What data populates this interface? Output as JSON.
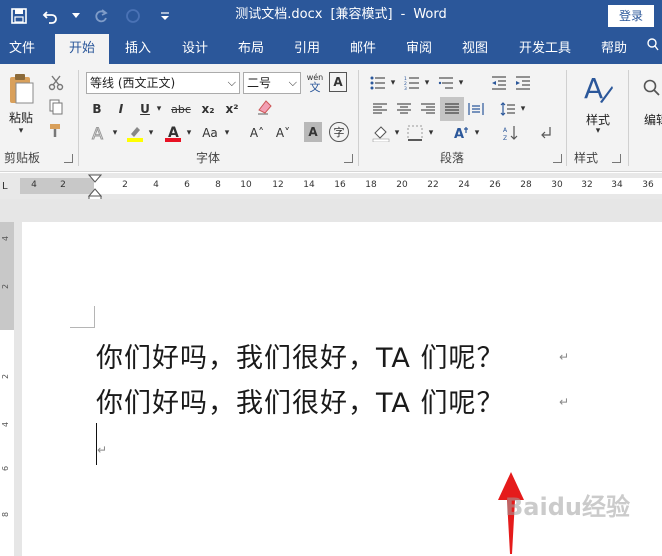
{
  "app": {
    "title_doc": "测试文档.docx",
    "title_mode": "[兼容模式]",
    "title_sep": "-",
    "app_name": "Word",
    "login_label": "登录"
  },
  "tabs": [
    "文件",
    "开始",
    "插入",
    "设计",
    "布局",
    "引用",
    "邮件",
    "审阅",
    "视图",
    "开发工具",
    "帮助"
  ],
  "active_tab": "开始",
  "ribbon": {
    "clipboard": {
      "paste_label": "粘贴",
      "group_label": "剪贴板"
    },
    "font": {
      "font_name": "等线 (西文正文)",
      "font_size": "二号",
      "wen_label": "wén",
      "wen_char": "文",
      "a_box": "A",
      "bold": "B",
      "italic": "I",
      "underline": "U",
      "strike": "abc",
      "subscript": "x₂",
      "superscript": "x²",
      "grow": "A˄",
      "shrink": "A˅",
      "case": "Aa",
      "char_shade": "A",
      "enclose": "字",
      "group_label": "字体"
    },
    "paragraph": {
      "group_label": "段落"
    },
    "styles": {
      "styles_label": "样式",
      "group_label": "样式"
    },
    "editing": {
      "label": "编辑"
    }
  },
  "ruler": {
    "labels": [
      "4",
      "2",
      "2",
      "4",
      "6",
      "8",
      "10",
      "12",
      "14",
      "16",
      "18",
      "20",
      "22",
      "24",
      "26",
      "28",
      "30",
      "32",
      "34",
      "36"
    ],
    "tab_stop": "L"
  },
  "vruler": {
    "labels": [
      "4",
      "2",
      "2",
      "4",
      "6",
      "8"
    ]
  },
  "document": {
    "lines": [
      "你们好吗，我们很好，TA 们呢？",
      "你们好吗，我们很好，TA 们呢？"
    ],
    "para_mark": "↵"
  },
  "watermark": "Baidu经验",
  "colors": {
    "brand": "#2b579a",
    "ribbon": "#f3f3f3",
    "highlight": "#ffff00",
    "font_color": "#e81123",
    "arrow": "#e51b1b"
  }
}
